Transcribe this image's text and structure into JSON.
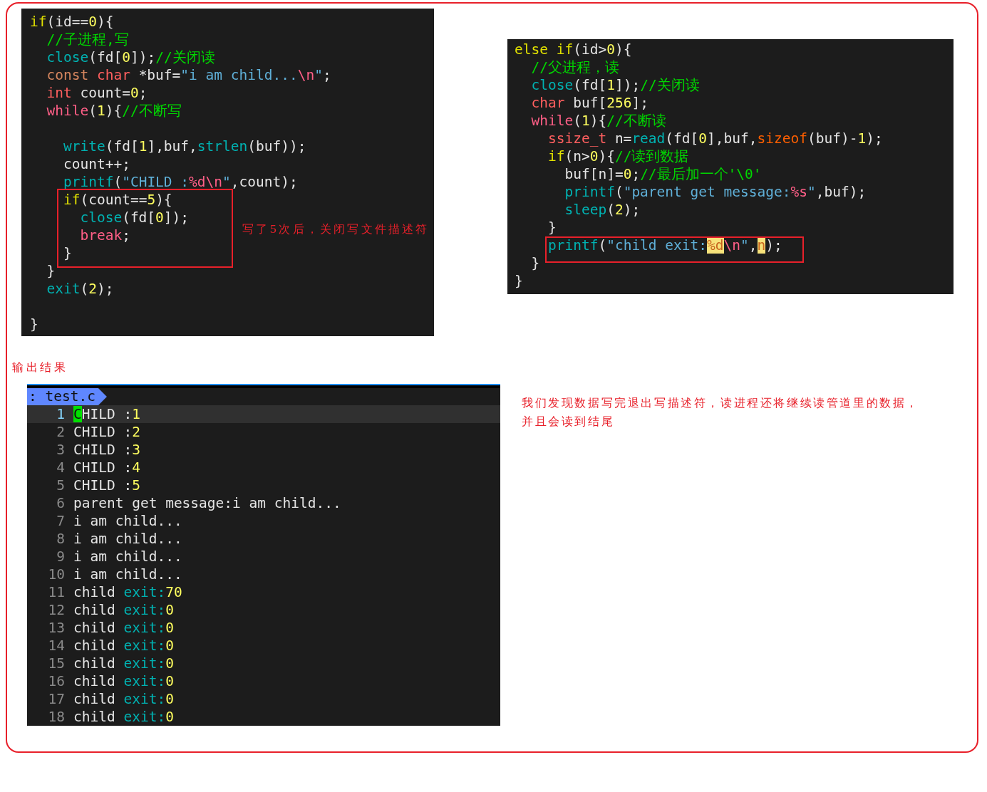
{
  "child_code": {
    "segments": [
      {
        "kind": "plain",
        "lines": [
          {
            "kind": "code",
            "tokens": [
              {
                "text": "if",
                "kind": "kw"
              },
              {
                "text": "(id==",
                "kind": "plain"
              },
              {
                "text": "0",
                "kind": "num"
              },
              {
                "text": "){",
                "kind": "plain"
              }
            ]
          },
          {
            "kind": "code",
            "tokens": [
              {
                "text": "  //子进程,写",
                "kind": "comment"
              }
            ]
          },
          {
            "kind": "code",
            "tokens": [
              {
                "text": "  close",
                "kind": "func"
              },
              {
                "text": "(fd[",
                "kind": "plain"
              },
              {
                "text": "0",
                "kind": "num"
              },
              {
                "text": "]);",
                "kind": "plain"
              },
              {
                "text": "//关闭读",
                "kind": "comment"
              }
            ]
          },
          {
            "kind": "code",
            "tokens": [
              {
                "text": "  const",
                "kind": "storage"
              },
              {
                "text": " char",
                "kind": "type"
              },
              {
                "text": " *buf=",
                "kind": "plain"
              },
              {
                "text": "\"i am child...",
                "kind": "str"
              },
              {
                "text": "\\n",
                "kind": "esc"
              },
              {
                "text": "\"",
                "kind": "str"
              },
              {
                "text": ";",
                "kind": "plain"
              }
            ]
          },
          {
            "kind": "code",
            "tokens": [
              {
                "text": "  int",
                "kind": "type"
              },
              {
                "text": " count=",
                "kind": "plain"
              },
              {
                "text": "0",
                "kind": "num"
              },
              {
                "text": ";",
                "kind": "plain"
              }
            ]
          },
          {
            "kind": "code",
            "tokens": [
              {
                "text": "  while",
                "kind": "ctrl"
              },
              {
                "text": "(",
                "kind": "plain"
              },
              {
                "text": "1",
                "kind": "num"
              },
              {
                "text": "){",
                "kind": "plain"
              },
              {
                "text": "//不断写",
                "kind": "comment"
              }
            ]
          },
          {
            "kind": "blank"
          },
          {
            "kind": "code",
            "tokens": [
              {
                "text": "    write",
                "kind": "func"
              },
              {
                "text": "(fd[",
                "kind": "plain"
              },
              {
                "text": "1",
                "kind": "num"
              },
              {
                "text": "],buf,",
                "kind": "plain"
              },
              {
                "text": "strlen",
                "kind": "func"
              },
              {
                "text": "(buf));",
                "kind": "plain"
              }
            ]
          },
          {
            "kind": "code",
            "tokens": [
              {
                "text": "    count++;",
                "kind": "plain"
              }
            ]
          },
          {
            "kind": "code",
            "tokens": [
              {
                "text": "    printf",
                "kind": "func"
              },
              {
                "text": "(",
                "kind": "plain"
              },
              {
                "text": "\"CHILD :",
                "kind": "str"
              },
              {
                "text": "%d\\n",
                "kind": "esc"
              },
              {
                "text": "\"",
                "kind": "str"
              },
              {
                "text": ",count);",
                "kind": "plain"
              }
            ]
          }
        ]
      },
      {
        "kind": "boxed",
        "note": "写了5次后，关闭写文件描述符",
        "lines": [
          {
            "kind": "code",
            "tokens": [
              {
                "text": "    if",
                "kind": "kw"
              },
              {
                "text": "(count==",
                "kind": "plain"
              },
              {
                "text": "5",
                "kind": "num"
              },
              {
                "text": "){",
                "kind": "plain"
              }
            ]
          },
          {
            "kind": "code",
            "tokens": [
              {
                "text": "      close",
                "kind": "func"
              },
              {
                "text": "(fd[",
                "kind": "plain"
              },
              {
                "text": "0",
                "kind": "num"
              },
              {
                "text": "]);",
                "kind": "plain"
              }
            ]
          },
          {
            "kind": "code",
            "tokens": [
              {
                "text": "      break",
                "kind": "ctrl"
              },
              {
                "text": ";",
                "kind": "plain"
              }
            ]
          },
          {
            "kind": "code",
            "tokens": [
              {
                "text": "    }",
                "kind": "plain"
              }
            ]
          }
        ]
      },
      {
        "kind": "plain",
        "lines": [
          {
            "kind": "code",
            "tokens": [
              {
                "text": "  }",
                "kind": "plain"
              }
            ]
          },
          {
            "kind": "code",
            "tokens": [
              {
                "text": "  exit",
                "kind": "func"
              },
              {
                "text": "(",
                "kind": "plain"
              },
              {
                "text": "2",
                "kind": "num"
              },
              {
                "text": ");",
                "kind": "plain"
              }
            ]
          },
          {
            "kind": "blank"
          },
          {
            "kind": "code",
            "tokens": [
              {
                "text": "}",
                "kind": "plain"
              }
            ]
          }
        ]
      }
    ]
  },
  "parent_code": {
    "segments": [
      {
        "kind": "plain",
        "lines": [
          {
            "kind": "code",
            "tokens": [
              {
                "text": "else if",
                "kind": "kw"
              },
              {
                "text": "(id>",
                "kind": "plain"
              },
              {
                "text": "0",
                "kind": "num"
              },
              {
                "text": "){",
                "kind": "plain"
              }
            ]
          },
          {
            "kind": "code",
            "tokens": [
              {
                "text": "  //父进程，读",
                "kind": "comment"
              }
            ]
          },
          {
            "kind": "code",
            "tokens": [
              {
                "text": "  close",
                "kind": "func"
              },
              {
                "text": "(fd[",
                "kind": "plain"
              },
              {
                "text": "1",
                "kind": "num"
              },
              {
                "text": "]);",
                "kind": "plain"
              },
              {
                "text": "//关闭读",
                "kind": "comment"
              }
            ]
          },
          {
            "kind": "code",
            "tokens": [
              {
                "text": "  char",
                "kind": "type"
              },
              {
                "text": " buf[",
                "kind": "plain"
              },
              {
                "text": "256",
                "kind": "num"
              },
              {
                "text": "];",
                "kind": "plain"
              }
            ]
          },
          {
            "kind": "code",
            "tokens": [
              {
                "text": "  while",
                "kind": "ctrl"
              },
              {
                "text": "(",
                "kind": "plain"
              },
              {
                "text": "1",
                "kind": "num"
              },
              {
                "text": "){",
                "kind": "plain"
              },
              {
                "text": "//不断读",
                "kind": "comment"
              }
            ]
          },
          {
            "kind": "code",
            "tokens": [
              {
                "text": "    ssize_t",
                "kind": "type"
              },
              {
                "text": " n=",
                "kind": "plain"
              },
              {
                "text": "read",
                "kind": "func"
              },
              {
                "text": "(fd[",
                "kind": "plain"
              },
              {
                "text": "0",
                "kind": "num"
              },
              {
                "text": "],buf,",
                "kind": "plain"
              },
              {
                "text": "sizeof",
                "kind": "builtin"
              },
              {
                "text": "(buf)-",
                "kind": "plain"
              },
              {
                "text": "1",
                "kind": "num"
              },
              {
                "text": ");",
                "kind": "plain"
              }
            ]
          },
          {
            "kind": "code",
            "tokens": [
              {
                "text": "    if",
                "kind": "kw"
              },
              {
                "text": "(n>",
                "kind": "plain"
              },
              {
                "text": "0",
                "kind": "num"
              },
              {
                "text": "){",
                "kind": "plain"
              },
              {
                "text": "//读到数据",
                "kind": "comment"
              }
            ]
          },
          {
            "kind": "code",
            "tokens": [
              {
                "text": "      buf[n]=",
                "kind": "plain"
              },
              {
                "text": "0",
                "kind": "num"
              },
              {
                "text": ";",
                "kind": "plain"
              },
              {
                "text": "//最后加一个'\\0'",
                "kind": "comment"
              }
            ]
          },
          {
            "kind": "code",
            "tokens": [
              {
                "text": "      printf",
                "kind": "func"
              },
              {
                "text": "(",
                "kind": "plain"
              },
              {
                "text": "\"parent get message:",
                "kind": "str"
              },
              {
                "text": "%s",
                "kind": "esc"
              },
              {
                "text": "\"",
                "kind": "str"
              },
              {
                "text": ",buf);",
                "kind": "plain"
              }
            ]
          },
          {
            "kind": "code",
            "tokens": [
              {
                "text": "      sleep",
                "kind": "func"
              },
              {
                "text": "(",
                "kind": "plain"
              },
              {
                "text": "2",
                "kind": "num"
              },
              {
                "text": ");",
                "kind": "plain"
              }
            ]
          },
          {
            "kind": "code",
            "tokens": [
              {
                "text": "    }",
                "kind": "plain"
              }
            ]
          }
        ]
      },
      {
        "kind": "boxed",
        "lines": [
          {
            "kind": "code",
            "tokens": [
              {
                "text": "    printf",
                "kind": "func"
              },
              {
                "text": "(",
                "kind": "plain"
              },
              {
                "text": "\"child exit:",
                "kind": "str"
              },
              {
                "text": "%d",
                "kind": "match"
              },
              {
                "text": "\\n",
                "kind": "esc"
              },
              {
                "text": "\"",
                "kind": "str"
              },
              {
                "text": ",",
                "kind": "plain"
              },
              {
                "text": "n",
                "kind": "match"
              },
              {
                "text": ");",
                "kind": "plain"
              }
            ]
          }
        ]
      },
      {
        "kind": "plain",
        "lines": [
          {
            "kind": "code",
            "tokens": [
              {
                "text": "  }",
                "kind": "plain"
              }
            ]
          },
          {
            "kind": "code",
            "tokens": [
              {
                "text": "}",
                "kind": "plain"
              }
            ]
          }
        ]
      }
    ]
  },
  "output_caption": "输出结果",
  "output": {
    "tab": ": test.c",
    "rows": [
      {
        "number": "1",
        "current": true,
        "tokens": [
          {
            "text": "C",
            "kind": "cursor"
          },
          {
            "text": "HILD :",
            "kind": "plain"
          },
          {
            "text": "1",
            "kind": "num"
          }
        ]
      },
      {
        "number": "2",
        "current": false,
        "tokens": [
          {
            "text": "CHILD :",
            "kind": "plain"
          },
          {
            "text": "2",
            "kind": "num"
          }
        ]
      },
      {
        "number": "3",
        "current": false,
        "tokens": [
          {
            "text": "CHILD :",
            "kind": "plain"
          },
          {
            "text": "3",
            "kind": "num"
          }
        ]
      },
      {
        "number": "4",
        "current": false,
        "tokens": [
          {
            "text": "CHILD :",
            "kind": "plain"
          },
          {
            "text": "4",
            "kind": "num"
          }
        ]
      },
      {
        "number": "5",
        "current": false,
        "tokens": [
          {
            "text": "CHILD :",
            "kind": "plain"
          },
          {
            "text": "5",
            "kind": "num"
          }
        ]
      },
      {
        "number": "6",
        "current": false,
        "tokens": [
          {
            "text": "parent get message:i am child...",
            "kind": "plain"
          }
        ]
      },
      {
        "number": "7",
        "current": false,
        "tokens": [
          {
            "text": "i am child...",
            "kind": "plain"
          }
        ]
      },
      {
        "number": "8",
        "current": false,
        "tokens": [
          {
            "text": "i am child...",
            "kind": "plain"
          }
        ]
      },
      {
        "number": "9",
        "current": false,
        "tokens": [
          {
            "text": "i am child...",
            "kind": "plain"
          }
        ]
      },
      {
        "number": "10",
        "current": false,
        "tokens": [
          {
            "text": "i am child...",
            "kind": "plain"
          }
        ]
      },
      {
        "number": "11",
        "current": false,
        "tokens": [
          {
            "text": "child ",
            "kind": "plain"
          },
          {
            "text": "exit:",
            "kind": "func"
          },
          {
            "text": "70",
            "kind": "num"
          }
        ]
      },
      {
        "number": "12",
        "current": false,
        "tokens": [
          {
            "text": "child ",
            "kind": "plain"
          },
          {
            "text": "exit:",
            "kind": "func"
          },
          {
            "text": "0",
            "kind": "num"
          }
        ]
      },
      {
        "number": "13",
        "current": false,
        "tokens": [
          {
            "text": "child ",
            "kind": "plain"
          },
          {
            "text": "exit:",
            "kind": "func"
          },
          {
            "text": "0",
            "kind": "num"
          }
        ]
      },
      {
        "number": "14",
        "current": false,
        "tokens": [
          {
            "text": "child ",
            "kind": "plain"
          },
          {
            "text": "exit:",
            "kind": "func"
          },
          {
            "text": "0",
            "kind": "num"
          }
        ]
      },
      {
        "number": "15",
        "current": false,
        "tokens": [
          {
            "text": "child ",
            "kind": "plain"
          },
          {
            "text": "exit:",
            "kind": "func"
          },
          {
            "text": "0",
            "kind": "num"
          }
        ]
      },
      {
        "number": "16",
        "current": false,
        "tokens": [
          {
            "text": "child ",
            "kind": "plain"
          },
          {
            "text": "exit:",
            "kind": "func"
          },
          {
            "text": "0",
            "kind": "num"
          }
        ]
      },
      {
        "number": "17",
        "current": false,
        "tokens": [
          {
            "text": "child ",
            "kind": "plain"
          },
          {
            "text": "exit:",
            "kind": "func"
          },
          {
            "text": "0",
            "kind": "num"
          }
        ]
      },
      {
        "number": "18",
        "current": false,
        "tokens": [
          {
            "text": "child ",
            "kind": "plain"
          },
          {
            "text": "exit:",
            "kind": "func"
          },
          {
            "text": "0",
            "kind": "num"
          }
        ]
      }
    ]
  },
  "conclusion": "我们发现数据写完退出写描述符，读进程还将继续读管道里的数据，并且会读到结尾"
}
